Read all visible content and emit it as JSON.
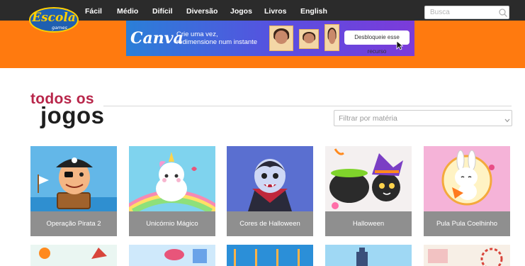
{
  "header": {
    "logo_text": "Escola",
    "logo_subtext": "games",
    "nav": [
      "Fácil",
      "Médio",
      "Difícil",
      "Diversão",
      "Jogos",
      "Livros",
      "English"
    ],
    "search_placeholder": "Busca"
  },
  "ad": {
    "brand": "Canva",
    "text": "Crie uma vez,\nredimensione num instante",
    "cta": "Desbloqueie esse recurso"
  },
  "main": {
    "title_line1": "todos os",
    "title_line2": "jogos",
    "filter_placeholder": "Filtrar por matéria"
  },
  "games": [
    {
      "label": "Operação Pirata 2",
      "bg": "#63b7e8"
    },
    {
      "label": "Unicórnio Mágico",
      "bg": "#7fd3ee"
    },
    {
      "label": "Cores de Halloween",
      "bg": "#5a6fd0"
    },
    {
      "label": "Halloween",
      "bg": "#f4f0f0"
    },
    {
      "label": "Pula Pula Coelhinho",
      "bg": "#f5b3d8"
    }
  ],
  "colors": {
    "accent_orange": "#ff7a0f",
    "topbar": "#2b2b2b",
    "title_red": "#b8264a",
    "card_label_bg": "#8f8f8f"
  }
}
